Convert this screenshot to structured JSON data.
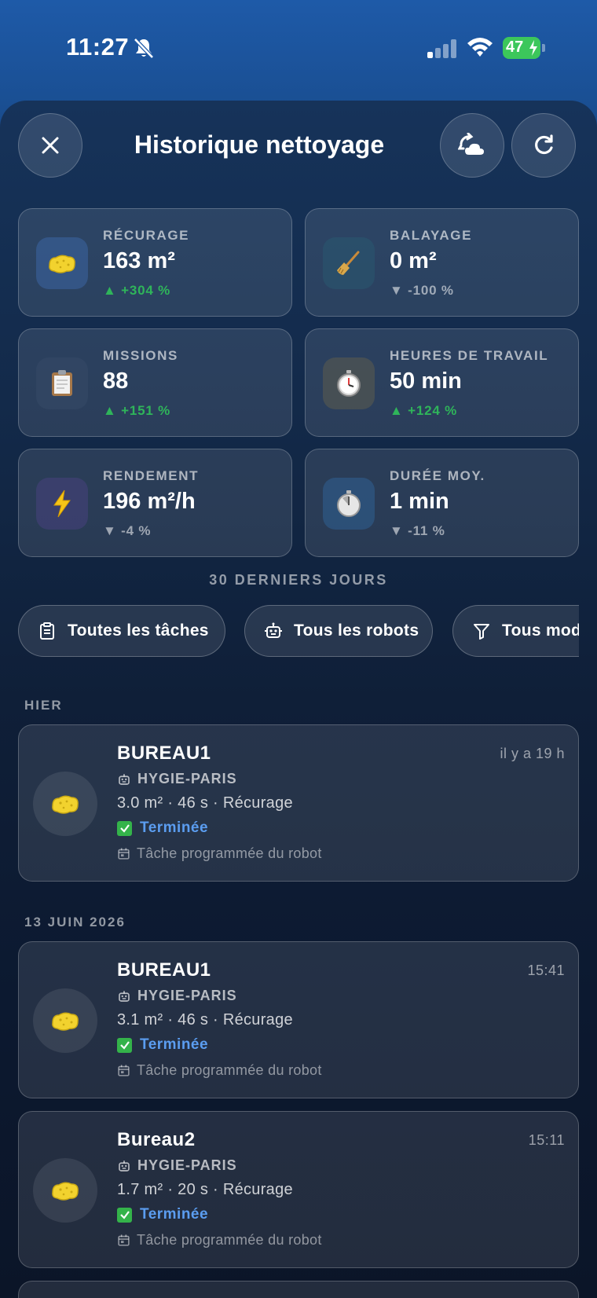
{
  "status_bar": {
    "time": "11:27",
    "battery": "47"
  },
  "header": {
    "title": "Historique nettoyage"
  },
  "stats": [
    {
      "label": "RÉCURAGE",
      "value": "163 m²",
      "delta": "▲ +304 %",
      "trend": "up",
      "icon": "sponge-icon"
    },
    {
      "label": "BALAYAGE",
      "value": "0 m²",
      "delta": "▼ -100 %",
      "trend": "down",
      "icon": "broom-icon"
    },
    {
      "label": "MISSIONS",
      "value": "88",
      "delta": "▲ +151 %",
      "trend": "up",
      "icon": "clipboard-icon"
    },
    {
      "label": "HEURES DE TRAVAIL",
      "value": "50 min",
      "delta": "▲ +124 %",
      "trend": "up",
      "icon": "stopwatch-icon"
    },
    {
      "label": "RENDEMENT",
      "value": "196 m²/h",
      "delta": "▼ -4 %",
      "trend": "down",
      "icon": "lightning-icon"
    },
    {
      "label": "DURÉE MOY.",
      "value": "1 min",
      "delta": "▼ -11 %",
      "trend": "down",
      "icon": "timer-icon"
    }
  ],
  "period": "30 DERNIERS JOURS",
  "filters": [
    {
      "label": "Toutes les tâches",
      "icon": "clipboard-list-icon"
    },
    {
      "label": "Tous les robots",
      "icon": "robot-icon"
    },
    {
      "label": "Tous mod",
      "icon": "filter-icon"
    }
  ],
  "sections": [
    {
      "label": "HIER",
      "missions": [
        {
          "name": "BUREAU1",
          "time": "il y a 19 h",
          "robot": "HYGIE-PARIS",
          "details": "3.0 m² · 46 s · Récurage",
          "status": "Terminée",
          "source": "Tâche programmée du robot"
        }
      ]
    },
    {
      "label": "13 JUIN 2026",
      "missions": [
        {
          "name": "BUREAU1",
          "time": "15:41",
          "robot": "HYGIE-PARIS",
          "details": "3.1 m² · 46 s · Récurage",
          "status": "Terminée",
          "source": "Tâche programmée du robot"
        },
        {
          "name": "Bureau2",
          "time": "15:11",
          "robot": "HYGIE-PARIS",
          "details": "1.7 m² · 20 s · Récurage",
          "status": "Terminée",
          "source": "Tâche programmée du robot"
        }
      ]
    }
  ],
  "colors": {
    "accent": "#5b9df0",
    "positive": "#2fb45a",
    "battery": "#3cc75b"
  }
}
